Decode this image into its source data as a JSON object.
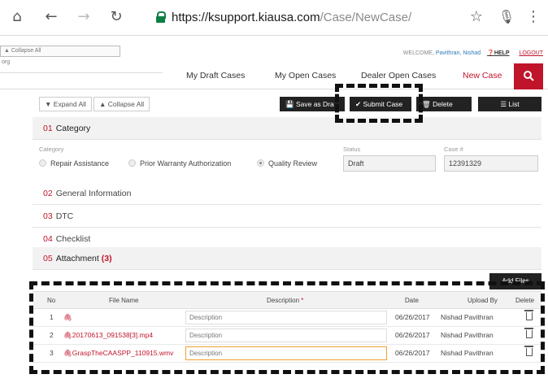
{
  "browser": {
    "url_host": "https://ksupport.kiausa.com",
    "url_path": "/Case/NewCase/"
  },
  "site": {
    "mini_collapse": "▲ Collapse All",
    "mini_sub": "org",
    "welcome_prefix": "WELCOME,",
    "welcome_user": "Pavithran, Nishad",
    "help_label": "HELP",
    "logout_label": "LOGOUT"
  },
  "nav": {
    "draft": "My Draft Cases",
    "open": "My Open Cases",
    "dealer": "Dealer Open Cases",
    "new": "New Case"
  },
  "toolbar": {
    "expand": "▼ Expand All",
    "collapse": "▲ Collapse All",
    "save": "Save as Dra",
    "submit": "✔ Submit Case",
    "delete": "Delete Case",
    "list": "List"
  },
  "sections": {
    "s1_num": "01",
    "s1_title": "Category",
    "s2_num": "02",
    "s2_title": "General Information",
    "s3_num": "03",
    "s3_title": "DTC",
    "s4_num": "04",
    "s4_title": "Checklist",
    "s5_num": "05",
    "s5_title": "Attachment",
    "s5_count": "(3)"
  },
  "category": {
    "label": "Category",
    "options": [
      "Repair Assistance",
      "Prior Warranty Authorization",
      "Quality Review"
    ],
    "status_label": "Status",
    "status_value": "Draft",
    "case_label": "Case #",
    "case_value": "12391329"
  },
  "attachments": {
    "add_files": "Add Files",
    "headers": {
      "no": "No",
      "file": "File Name",
      "desc": "Description",
      "req": "*",
      "date": "Date",
      "upload": "Upload By",
      "delete": "Delete"
    },
    "desc_placeholder": "Description",
    "rows": [
      {
        "no": "1",
        "file": "",
        "date": "06/26/2017",
        "by": "Nishad Pavithran"
      },
      {
        "no": "2",
        "file": "20170613_091538[3].mp4",
        "date": "06/26/2017",
        "by": "Nishad Pavithran"
      },
      {
        "no": "3",
        "file": "GraspTheCAASPP_110915.wmv",
        "date": "06/26/2017",
        "by": "Nishad Pavithran"
      }
    ]
  }
}
